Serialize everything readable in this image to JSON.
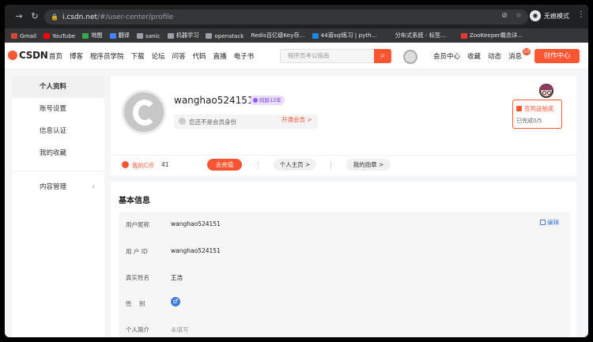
{
  "browser": {
    "url_host": "i.csdn.net",
    "url_path": "/#/user-center/profile",
    "incognito_label": "无痕模式"
  },
  "bookmarks": [
    {
      "label": "Gmail",
      "color": "#d44638"
    },
    {
      "label": "YouTube",
      "color": "#ff0000"
    },
    {
      "label": "地图",
      "color": "#34a853"
    },
    {
      "label": "翻译",
      "color": "#4285f4"
    },
    {
      "label": "sanic",
      "color": "#9aa0a6"
    },
    {
      "label": "机器学习",
      "color": "#9aa0a6"
    },
    {
      "label": "openstack",
      "color": "#9aa0a6"
    },
    {
      "label": "Redis百亿级Key存...",
      "color": "#9aa0a6"
    },
    {
      "label": "44道sql练习 | pyth...",
      "color": "#1e88e5"
    },
    {
      "label": "分布式系统 - 标签...",
      "color": "#9aa0a6"
    },
    {
      "label": "ZooKeeper概念详...",
      "color": "#e53935"
    }
  ],
  "header": {
    "logo": "CSDN",
    "nav": [
      "首页",
      "博客",
      "程序员学院",
      "下载",
      "论坛",
      "问答",
      "代码",
      "直播",
      "电子书"
    ],
    "search_placeholder": "程序员考公指南",
    "right_nav": [
      "会员中心",
      "收藏",
      "动态",
      "消息"
    ],
    "message_count": "10",
    "create_label": "创作中心",
    "accent_color": "#fc5531"
  },
  "sidebar": {
    "items": [
      {
        "label": "个人资料",
        "active": true
      },
      {
        "label": "账号设置"
      },
      {
        "label": "信息认证"
      },
      {
        "label": "我的收藏"
      }
    ],
    "group": {
      "label": "内容管理"
    }
  },
  "profile": {
    "username": "wanghao524151",
    "age_badge": "码龄12年",
    "member_prompt": "您还不是会员身份",
    "member_link": "开通会员 >",
    "signin_title": "签到送抽奖",
    "signin_progress": "已完成0/5",
    "cbi_label": "我的C币",
    "cbi_value": "41",
    "recharge_label": "去充值",
    "homepage_label": "个人主页 >",
    "medal_label": "我的勋章 >"
  },
  "basic_info": {
    "title": "基本信息",
    "edit_label": "编辑",
    "rows": [
      {
        "label": "用户昵称",
        "value": "wanghao524151"
      },
      {
        "label": "用 户 ID",
        "value": "wanghao524151"
      },
      {
        "label": "真实姓名",
        "value": "王浩"
      },
      {
        "label": "性    别",
        "value": "♂"
      },
      {
        "label": "个人简介",
        "value": "未填写"
      }
    ]
  }
}
